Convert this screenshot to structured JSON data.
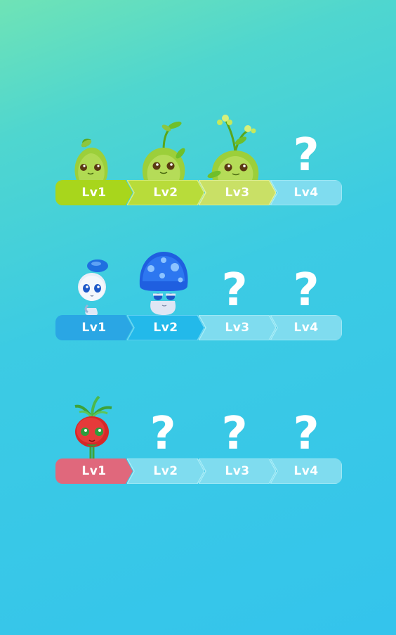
{
  "colors": {
    "locked": "#7fdcef",
    "chevron_edge": "#a8ecf7"
  },
  "rows": [
    {
      "family": "sprout",
      "levels": [
        {
          "label": "Lv1",
          "state": "unlocked",
          "color": "#a8d61c"
        },
        {
          "label": "Lv2",
          "state": "unlocked",
          "color": "#b8dc3a"
        },
        {
          "label": "Lv3",
          "state": "unlocked",
          "color": "#c9e066"
        },
        {
          "label": "Lv4",
          "state": "locked",
          "mark": "?"
        }
      ]
    },
    {
      "family": "mushroom",
      "levels": [
        {
          "label": "Lv1",
          "state": "unlocked",
          "color": "#2aa6e4"
        },
        {
          "label": "Lv2",
          "state": "unlocked",
          "color": "#23b9ea"
        },
        {
          "label": "Lv3",
          "state": "locked",
          "mark": "?"
        },
        {
          "label": "Lv4",
          "state": "locked",
          "mark": "?"
        }
      ]
    },
    {
      "family": "radish",
      "levels": [
        {
          "label": "Lv1",
          "state": "unlocked",
          "color": "#e0687c"
        },
        {
          "label": "Lv2",
          "state": "locked",
          "mark": "?"
        },
        {
          "label": "Lv3",
          "state": "locked",
          "mark": "?"
        },
        {
          "label": "Lv4",
          "state": "locked",
          "mark": "?"
        }
      ]
    }
  ]
}
